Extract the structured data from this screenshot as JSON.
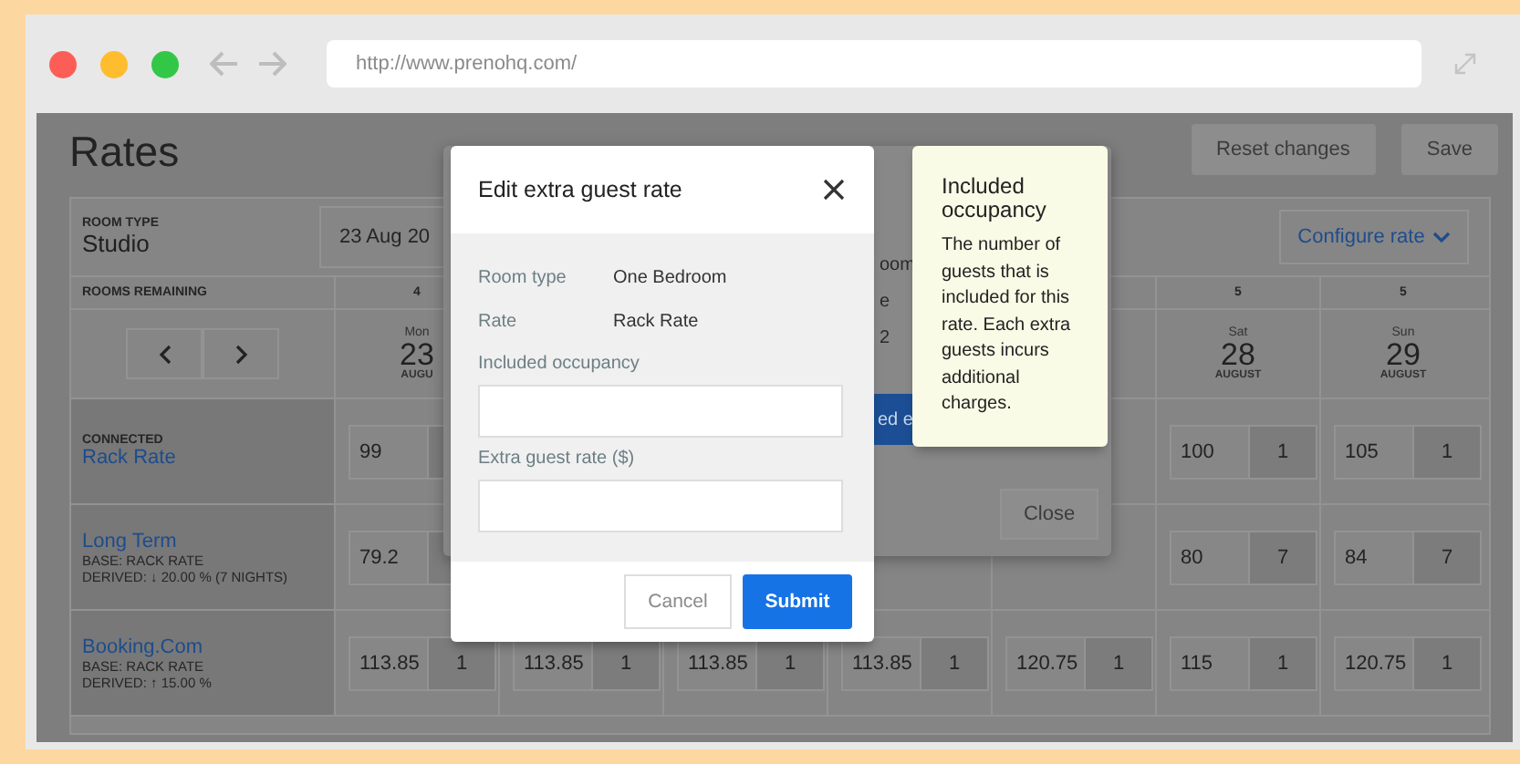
{
  "browser": {
    "url": "http://www.prenohq.com/"
  },
  "page": {
    "title": "Rates",
    "buttons": [
      "Reset changes",
      "Save"
    ]
  },
  "table": {
    "room_type_label": "ROOM TYPE",
    "room_type": "Studio",
    "date_range": "23 Aug 20",
    "configure_button": "Configure rate",
    "rooms_remaining_label": "ROOMS REMAINING",
    "days_start": [
      {
        "remaining": "4",
        "weekday": "Mon",
        "day": "23",
        "month": "AUGU"
      }
    ],
    "days_end": [
      {
        "remaining": "5",
        "weekday": "Sat",
        "day": "28",
        "month": "AUGUST"
      },
      {
        "remaining": "5",
        "weekday": "Sun",
        "day": "29",
        "month": "AUGUST"
      }
    ],
    "rates": [
      {
        "kind": "connected",
        "tag": "CONNECTED",
        "name": "Rack Rate",
        "cells_start": [
          {
            "price": "99"
          }
        ],
        "cells_end": [
          {
            "price": "100",
            "count": "1"
          },
          {
            "price": "105",
            "count": "1"
          }
        ]
      },
      {
        "kind": "derived",
        "name": "Long Term",
        "base": "BASE: RACK RATE",
        "derived": "DERIVED: ↓ 20.00 % (7 NIGHTS)",
        "cells_start": [
          {
            "price": "79.2"
          }
        ],
        "cells_end": [
          {
            "price": "80",
            "count": "7"
          },
          {
            "price": "84",
            "count": "7"
          }
        ]
      },
      {
        "kind": "derived",
        "name": "Booking.Com",
        "base": "BASE: RACK RATE",
        "derived": "DERIVED: ↑ 15.00 %",
        "cells_start": [
          {
            "price": "113.85",
            "count": "1"
          },
          {
            "price": "113.85",
            "count": "1"
          },
          {
            "price": "113.85",
            "count": "1"
          },
          {
            "price": "113.85",
            "count": "1"
          },
          {
            "price": "120.75",
            "count": "1"
          },
          {
            "price": "115",
            "count": "1"
          },
          {
            "price": "120.75",
            "count": "1"
          }
        ]
      }
    ]
  },
  "background_dialog": {
    "lines": [
      "oom",
      "e",
      "2"
    ],
    "primary_button": "ed e",
    "close_button": "Close"
  },
  "dialog": {
    "title": "Edit extra guest rate",
    "details": [
      {
        "label": "Room type",
        "value": "One Bedroom"
      },
      {
        "label": "Rate",
        "value": "Rack Rate"
      }
    ],
    "fields": [
      {
        "label": "Included occupancy"
      },
      {
        "label": "Extra guest rate ($)"
      }
    ],
    "cancel_button": "Cancel",
    "submit_button": "Submit"
  },
  "tooltip": {
    "title": "Included occupancy",
    "text": "The number of guests that is included for this rate. Each extra guests incurs additional charges."
  }
}
